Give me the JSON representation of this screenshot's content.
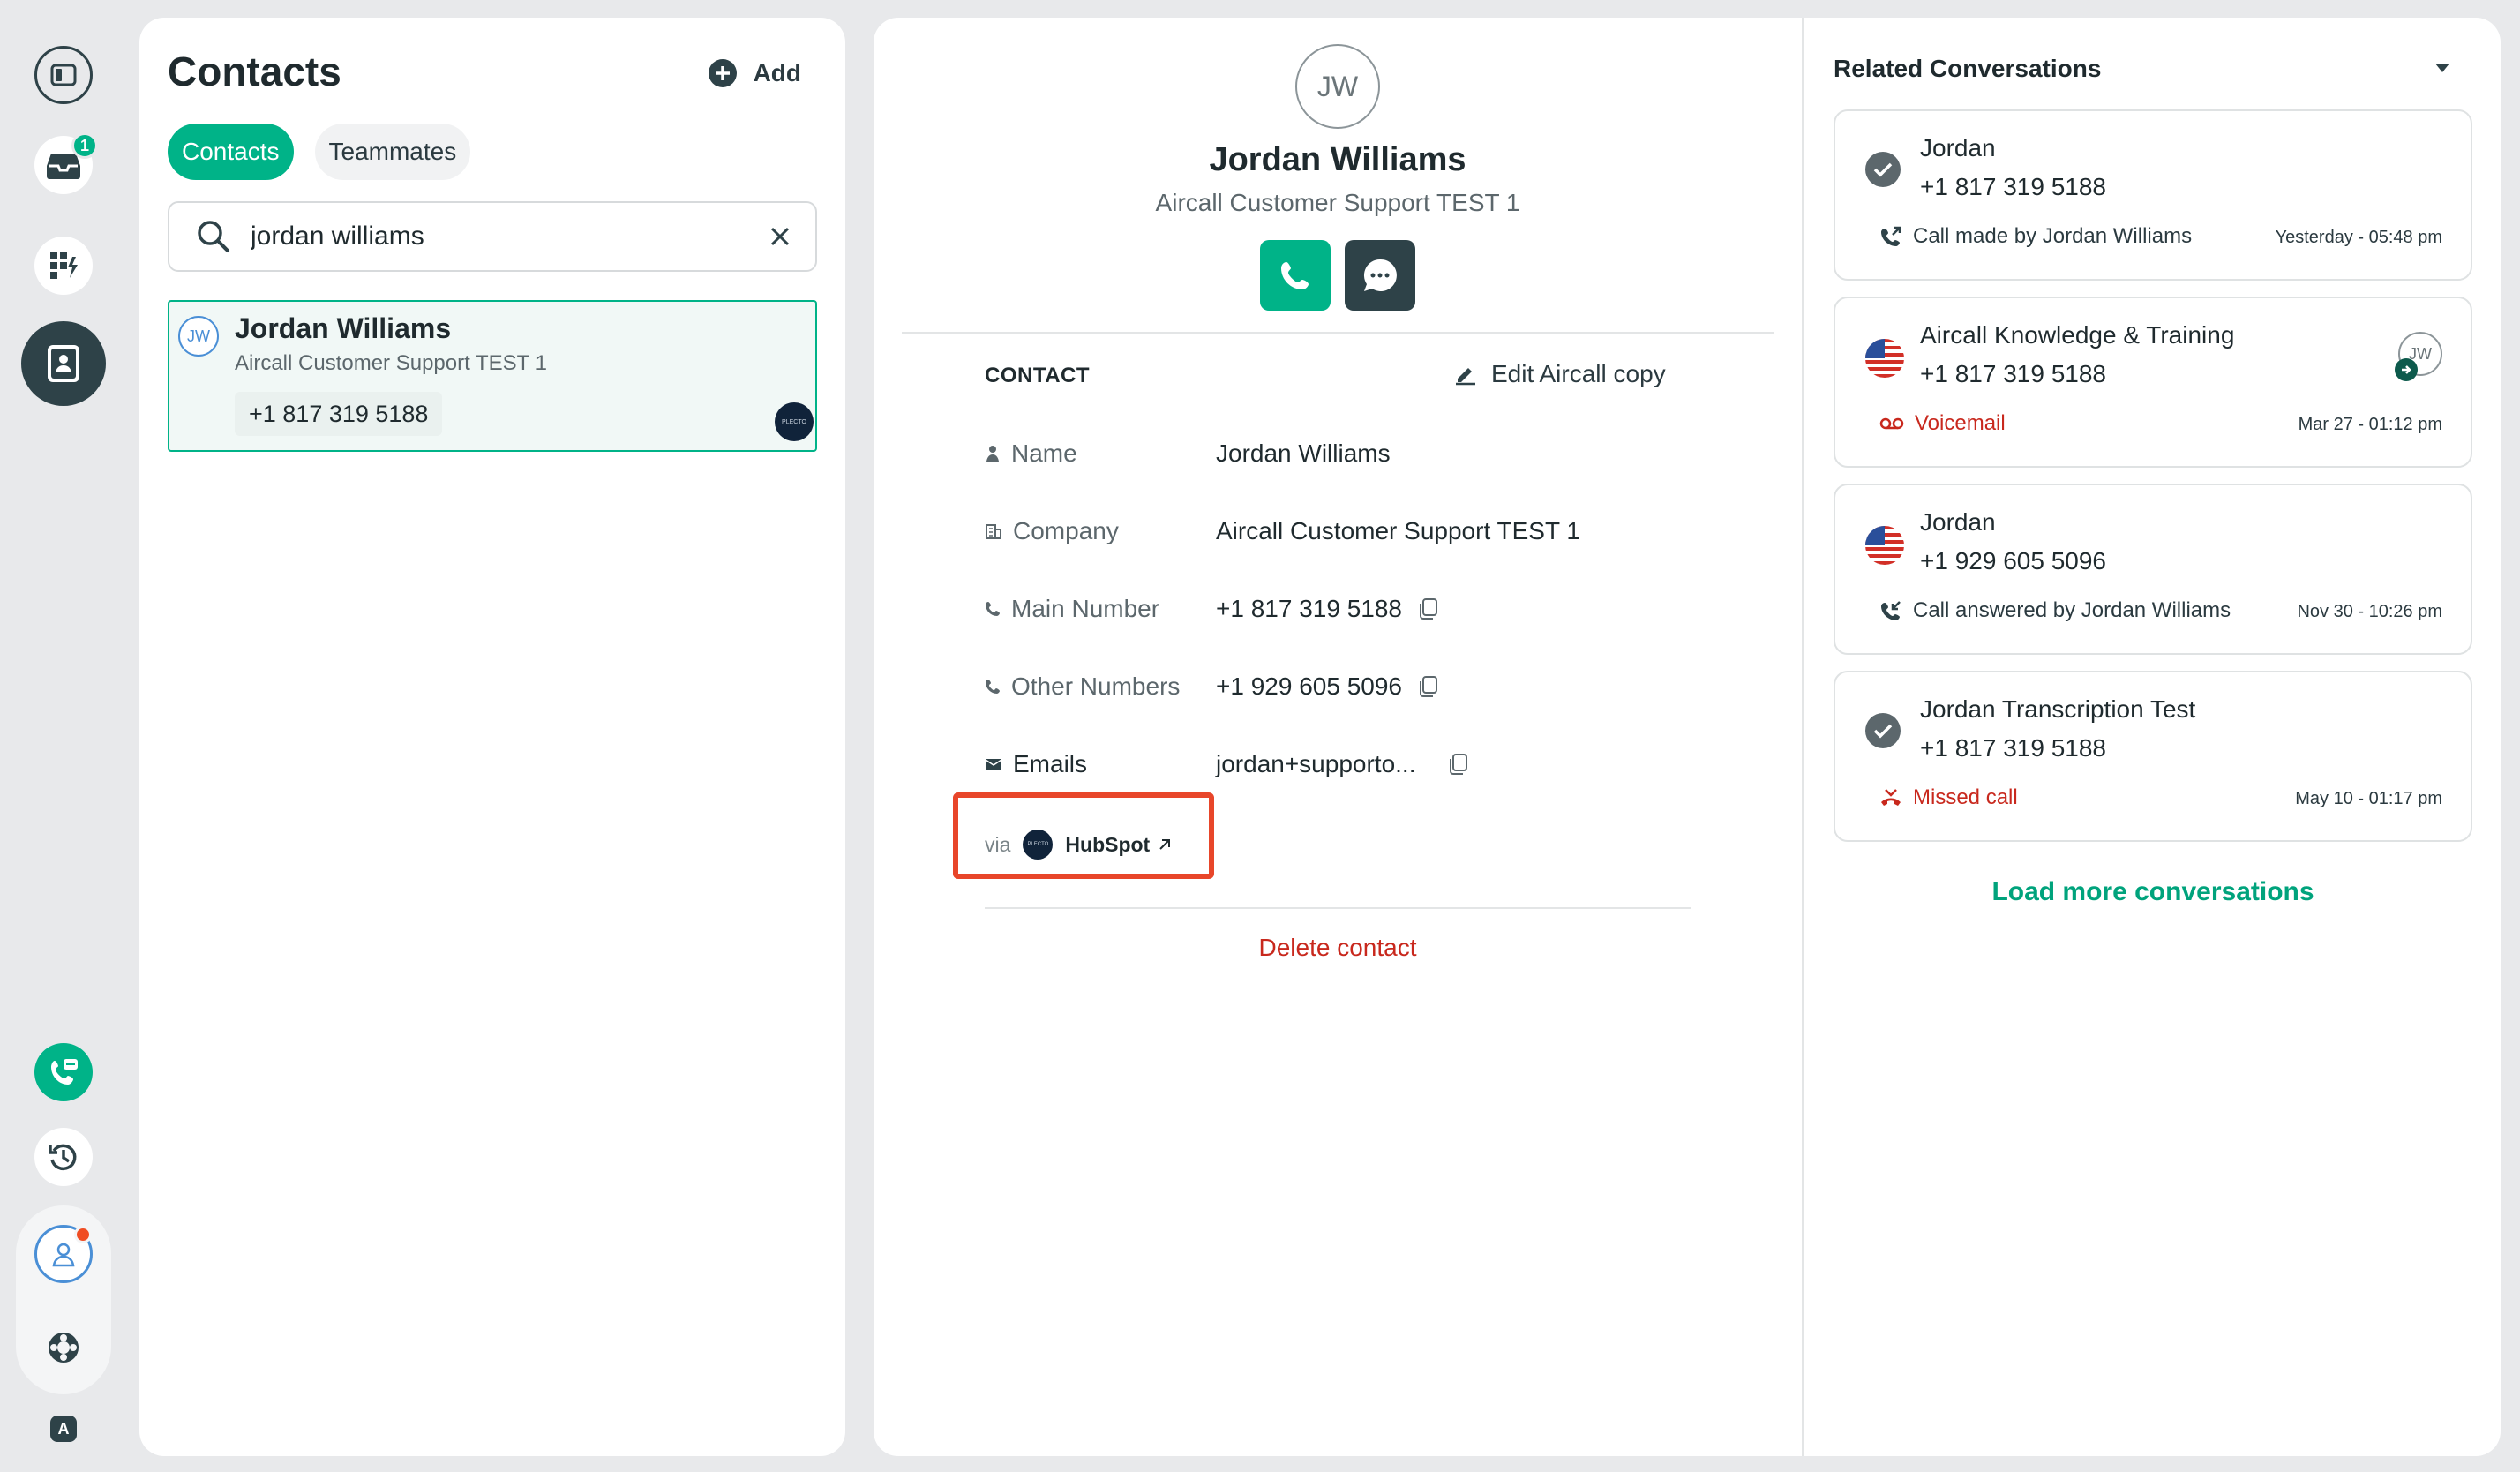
{
  "rail": {
    "inbox_badge": "1",
    "footer_letter": "A"
  },
  "contacts_panel": {
    "title": "Contacts",
    "add_label": "Add",
    "tabs": [
      {
        "label": "Contacts",
        "active": true
      },
      {
        "label": "Teammates",
        "active": false
      }
    ],
    "search": {
      "value": "jordan williams",
      "placeholder": "Search"
    },
    "results": [
      {
        "initials": "JW",
        "name": "Jordan Williams",
        "company": "Aircall Customer Support TEST 1",
        "phone": "+1 817 319 5188",
        "source_logo_text": "PLECTO"
      }
    ]
  },
  "contact_detail": {
    "initials": "JW",
    "name": "Jordan Williams",
    "company": "Aircall Customer Support TEST 1",
    "section_label": "CONTACT",
    "edit_label": "Edit Aircall copy",
    "fields": {
      "name": {
        "label": "Name",
        "value": "Jordan Williams"
      },
      "company": {
        "label": "Company",
        "value": "Aircall Customer Support TEST 1"
      },
      "main_number": {
        "label": "Main Number",
        "value": "+1 817 319 5188"
      },
      "other_numbers": {
        "label": "Other Numbers",
        "value": "+1 929 605 5096"
      },
      "emails": {
        "label": "Emails",
        "value": "jordan+supporto..."
      }
    },
    "via": {
      "prefix": "via",
      "integration": "HubSpot",
      "logo_text": "PLECTO"
    },
    "delete_label": "Delete contact"
  },
  "related": {
    "title": "Related Conversations",
    "conversations": [
      {
        "title": "Jordan",
        "phone": "+1 817 319 5188",
        "status": "Call made by Jordan Williams",
        "time": "Yesterday - 05:48 pm",
        "icon": "check-circle-icon",
        "status_icon": "outgoing-call-icon",
        "status_type": "normal"
      },
      {
        "title": "Aircall Knowledge & Training",
        "phone": "+1 817 319 5188",
        "status": "Voicemail",
        "time": "Mar 27 - 01:12 pm",
        "icon": "us-flag-icon",
        "status_icon": "voicemail-icon",
        "status_type": "red",
        "assignee_initials": "JW"
      },
      {
        "title": "Jordan",
        "phone": "+1 929 605 5096",
        "status": "Call answered by Jordan Williams",
        "time": "Nov 30 - 10:26 pm",
        "icon": "us-flag-icon",
        "status_icon": "incoming-call-icon",
        "status_type": "normal"
      },
      {
        "title": "Jordan Transcription Test",
        "phone": "+1 817 319 5188",
        "status": "Missed call",
        "time": "May 10 - 01:17 pm",
        "icon": "check-circle-icon",
        "status_icon": "missed-call-icon",
        "status_type": "red"
      }
    ],
    "load_more_label": "Load more conversations"
  },
  "colors": {
    "accent": "#00b388",
    "danger": "#c8281d",
    "highlight_box": "#e8462a",
    "dark": "#2e4248"
  }
}
